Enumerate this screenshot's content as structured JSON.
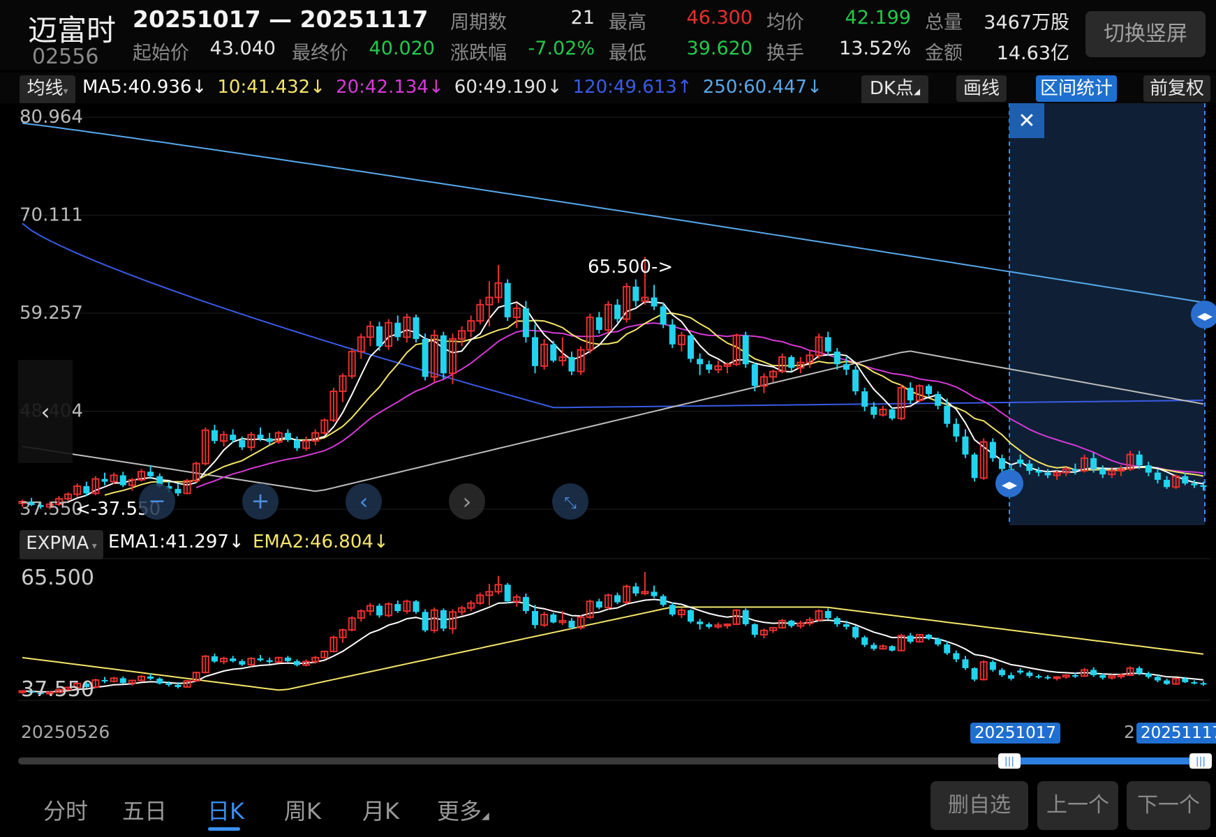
{
  "stock": {
    "name": "迈富时",
    "code": "02556",
    "range": "20251017 — 20251117"
  },
  "header": {
    "start_price_label": "起始价",
    "start_price": "43.040",
    "end_price_label": "最终价",
    "end_price": "40.020",
    "periods_label": "周期数",
    "periods": "21",
    "change_label": "涨跌幅",
    "change": "-7.02%",
    "high_label": "最高",
    "high": "46.300",
    "low_label": "最低",
    "low": "39.620",
    "avg_label": "均价",
    "avg": "42.199",
    "turnover_label": "换手",
    "turnover": "13.52%",
    "volume_label": "总量",
    "volume": "3467万股",
    "amount_label": "金额",
    "amount": "14.63亿",
    "toggle_button": "切换竖屏"
  },
  "ma_bar": {
    "selector": "均线",
    "ma5": "MA5:40.936↓",
    "ma10": "10:41.432↓",
    "ma20": "20:42.134↓",
    "ma60": "60:49.190↓",
    "ma120": "120:49.613↑",
    "ma250": "250:60.447↓",
    "dk_button": "DK点",
    "draw_button": "画线",
    "interval_button": "区间统计",
    "adjust_button": "前复权"
  },
  "main_chart": {
    "y_labels": [
      "80.964",
      "70.111",
      "59.257",
      "48.404",
      "37.550"
    ],
    "peak_annotation": "65.500->",
    "low_annotation": "<-37.550",
    "close_icon": "close-icon"
  },
  "sub_chart": {
    "selector": "EXPMA",
    "ema1": "EMA1:41.297↓",
    "ema2": "EMA2:46.804↓",
    "y_top": "65.500",
    "y_bottom": "37.550"
  },
  "timeline": {
    "start_date": "20250526",
    "sel_start": "20251017",
    "sel_end": "20251117",
    "partial": "2("
  },
  "tabs": [
    "分时",
    "五日",
    "日K",
    "周K",
    "月K",
    "更多"
  ],
  "active_tab": "日K",
  "bottom_buttons": {
    "remove_watch": "删自选",
    "prev": "上一个",
    "next": "下一个"
  },
  "colors": {
    "up": "#e8302f",
    "down": "#22d3ee",
    "ma5": "#ffffff",
    "ma10": "#f4e66a",
    "ma20": "#d63ad6",
    "ma60": "#bdbdbd",
    "ma120": "#3a5be6",
    "ma250": "#58a8ea",
    "accent": "#1f6fd0"
  },
  "chart_data": {
    "type": "candlestick",
    "ylim": [
      37.55,
      80.964
    ],
    "ohlc": [
      [
        38.2,
        38.6,
        37.8,
        38.4
      ],
      [
        38.4,
        38.8,
        37.9,
        38.0
      ],
      [
        38.0,
        38.3,
        37.6,
        37.8
      ],
      [
        37.8,
        38.4,
        37.55,
        38.1
      ],
      [
        38.1,
        39.0,
        37.9,
        38.7
      ],
      [
        38.7,
        39.4,
        38.5,
        39.2
      ],
      [
        39.2,
        40.4,
        38.9,
        40.1
      ],
      [
        40.1,
        40.6,
        39.0,
        39.3
      ],
      [
        39.3,
        41.2,
        39.1,
        40.9
      ],
      [
        40.9,
        41.6,
        40.2,
        40.6
      ],
      [
        40.6,
        41.6,
        40.3,
        41.3
      ],
      [
        41.3,
        41.7,
        40.0,
        40.2
      ],
      [
        40.2,
        41.0,
        39.6,
        40.8
      ],
      [
        40.8,
        42.0,
        40.6,
        41.7
      ],
      [
        41.7,
        42.4,
        40.9,
        41.2
      ],
      [
        41.2,
        41.5,
        39.9,
        40.1
      ],
      [
        40.1,
        40.6,
        39.4,
        39.8
      ],
      [
        39.8,
        40.4,
        39.0,
        39.3
      ],
      [
        39.3,
        40.9,
        39.2,
        40.7
      ],
      [
        40.7,
        42.8,
        40.5,
        42.6
      ],
      [
        42.6,
        46.6,
        42.4,
        46.3
      ],
      [
        46.3,
        46.9,
        44.8,
        45.1
      ],
      [
        45.1,
        46.2,
        44.5,
        45.8
      ],
      [
        45.8,
        46.4,
        44.9,
        45.2
      ],
      [
        45.2,
        45.6,
        44.1,
        44.4
      ],
      [
        44.4,
        46.1,
        44.0,
        45.8
      ],
      [
        45.8,
        46.6,
        45.1,
        45.4
      ],
      [
        45.4,
        46.0,
        44.6,
        45.0
      ],
      [
        45.0,
        46.2,
        44.8,
        46.0
      ],
      [
        46.0,
        46.4,
        45.0,
        45.2
      ],
      [
        45.2,
        45.6,
        44.0,
        44.3
      ],
      [
        44.3,
        45.6,
        44.0,
        45.1
      ],
      [
        45.1,
        46.4,
        44.6,
        46.0
      ],
      [
        46.0,
        47.6,
        45.8,
        47.4
      ],
      [
        47.4,
        51.0,
        47.2,
        50.6
      ],
      [
        50.6,
        52.6,
        49.4,
        52.3
      ],
      [
        52.3,
        55.4,
        52.0,
        55.0
      ],
      [
        55.0,
        57.0,
        54.2,
        56.6
      ],
      [
        56.6,
        58.4,
        55.6,
        57.8
      ],
      [
        57.8,
        58.3,
        55.1,
        55.6
      ],
      [
        55.6,
        58.6,
        55.2,
        58.2
      ],
      [
        58.2,
        59.0,
        56.2,
        56.6
      ],
      [
        56.6,
        59.2,
        56.0,
        58.8
      ],
      [
        58.8,
        59.1,
        56.0,
        56.4
      ],
      [
        56.4,
        57.0,
        51.8,
        52.2
      ],
      [
        52.2,
        57.4,
        51.6,
        56.8
      ],
      [
        56.8,
        57.2,
        52.0,
        52.6
      ],
      [
        52.6,
        57.0,
        51.4,
        56.4
      ],
      [
        56.4,
        57.8,
        55.6,
        57.3
      ],
      [
        57.3,
        59.0,
        56.6,
        58.4
      ],
      [
        58.4,
        60.8,
        58.0,
        60.2
      ],
      [
        60.2,
        62.8,
        57.8,
        61.0
      ],
      [
        61.0,
        64.6,
        60.4,
        62.6
      ],
      [
        62.6,
        63.0,
        58.4,
        58.8
      ],
      [
        58.8,
        60.4,
        57.6,
        59.8
      ],
      [
        59.8,
        60.6,
        56.0,
        56.6
      ],
      [
        56.6,
        58.0,
        52.6,
        53.4
      ],
      [
        53.4,
        56.4,
        53.0,
        55.8
      ],
      [
        55.8,
        56.2,
        53.8,
        54.0
      ],
      [
        54.0,
        56.6,
        53.4,
        54.4
      ],
      [
        54.4,
        55.0,
        52.4,
        52.8
      ],
      [
        52.8,
        55.6,
        52.4,
        55.2
      ],
      [
        55.2,
        59.2,
        54.8,
        58.8
      ],
      [
        58.8,
        59.4,
        57.0,
        57.4
      ],
      [
        57.4,
        60.6,
        57.0,
        60.2
      ],
      [
        60.2,
        60.8,
        58.2,
        58.6
      ],
      [
        58.6,
        62.6,
        58.2,
        62.2
      ],
      [
        62.2,
        63.0,
        60.0,
        60.6
      ],
      [
        60.6,
        65.5,
        60.2,
        61.0
      ],
      [
        61.0,
        62.4,
        59.6,
        60.0
      ],
      [
        60.0,
        60.4,
        57.6,
        58.0
      ],
      [
        58.0,
        58.6,
        55.4,
        55.8
      ],
      [
        55.8,
        57.2,
        55.0,
        56.8
      ],
      [
        56.8,
        57.0,
        53.8,
        54.2
      ],
      [
        54.2,
        54.8,
        52.4,
        53.6
      ],
      [
        53.6,
        54.0,
        52.6,
        53.0
      ],
      [
        53.0,
        54.0,
        52.6,
        53.4
      ],
      [
        53.4,
        53.8,
        52.6,
        53.6
      ],
      [
        53.6,
        57.0,
        53.4,
        56.8
      ],
      [
        56.8,
        57.2,
        53.2,
        53.6
      ],
      [
        53.6,
        53.8,
        50.6,
        51.2
      ],
      [
        51.2,
        52.6,
        50.4,
        52.2
      ],
      [
        52.2,
        53.0,
        51.6,
        52.8
      ],
      [
        52.8,
        54.8,
        52.6,
        54.4
      ],
      [
        54.4,
        54.6,
        52.8,
        53.2
      ],
      [
        53.2,
        54.4,
        52.6,
        53.8
      ],
      [
        53.8,
        55.2,
        53.2,
        54.6
      ],
      [
        54.6,
        57.0,
        54.2,
        56.6
      ],
      [
        56.6,
        57.2,
        54.6,
        55.0
      ],
      [
        55.0,
        55.4,
        53.0,
        53.6
      ],
      [
        53.6,
        54.4,
        52.4,
        53.0
      ],
      [
        53.0,
        53.4,
        50.2,
        50.6
      ],
      [
        50.6,
        51.0,
        48.4,
        48.9
      ],
      [
        48.9,
        49.4,
        47.6,
        48.0
      ],
      [
        48.0,
        49.0,
        47.8,
        48.6
      ],
      [
        48.6,
        48.8,
        47.4,
        47.6
      ],
      [
        47.6,
        51.4,
        47.4,
        51.0
      ],
      [
        51.0,
        51.6,
        49.2,
        49.6
      ],
      [
        49.6,
        51.4,
        49.4,
        51.2
      ],
      [
        51.2,
        51.4,
        50.0,
        50.3
      ],
      [
        50.3,
        50.6,
        48.6,
        49.0
      ],
      [
        49.0,
        49.8,
        46.6,
        47.0
      ],
      [
        47.0,
        47.6,
        45.0,
        45.6
      ],
      [
        45.6,
        46.4,
        43.2,
        43.6
      ],
      [
        43.6,
        43.8,
        40.6,
        41.0
      ],
      [
        41.0,
        45.4,
        40.8,
        45.0
      ],
      [
        45.0,
        45.4,
        42.8,
        43.2
      ],
      [
        43.2,
        43.6,
        41.6,
        42.0
      ],
      [
        42.0,
        42.6,
        40.8,
        41.2
      ],
      [
        43.04,
        43.6,
        42.2,
        42.6
      ],
      [
        42.6,
        43.0,
        41.4,
        41.8
      ],
      [
        41.8,
        42.2,
        41.2,
        41.6
      ],
      [
        41.6,
        42.0,
        41.0,
        41.3
      ],
      [
        41.3,
        41.8,
        40.8,
        41.6
      ],
      [
        41.6,
        42.2,
        41.2,
        42.0
      ],
      [
        42.0,
        42.6,
        41.4,
        41.8
      ],
      [
        41.8,
        43.6,
        41.6,
        43.2
      ],
      [
        43.2,
        43.8,
        41.6,
        42.0
      ],
      [
        42.0,
        42.4,
        41.0,
        41.4
      ],
      [
        41.4,
        42.2,
        41.0,
        41.8
      ],
      [
        41.8,
        42.4,
        41.2,
        42.0
      ],
      [
        42.0,
        44.0,
        41.8,
        43.6
      ],
      [
        43.6,
        44.0,
        42.0,
        42.4
      ],
      [
        42.4,
        42.8,
        41.2,
        41.6
      ],
      [
        41.6,
        42.0,
        40.4,
        40.8
      ],
      [
        40.8,
        41.2,
        39.8,
        40.0
      ],
      [
        40.0,
        41.4,
        39.8,
        41.2
      ],
      [
        41.2,
        41.6,
        40.2,
        40.4
      ],
      [
        40.4,
        40.8,
        39.9,
        40.2
      ],
      [
        40.2,
        40.6,
        39.62,
        40.02
      ]
    ]
  }
}
